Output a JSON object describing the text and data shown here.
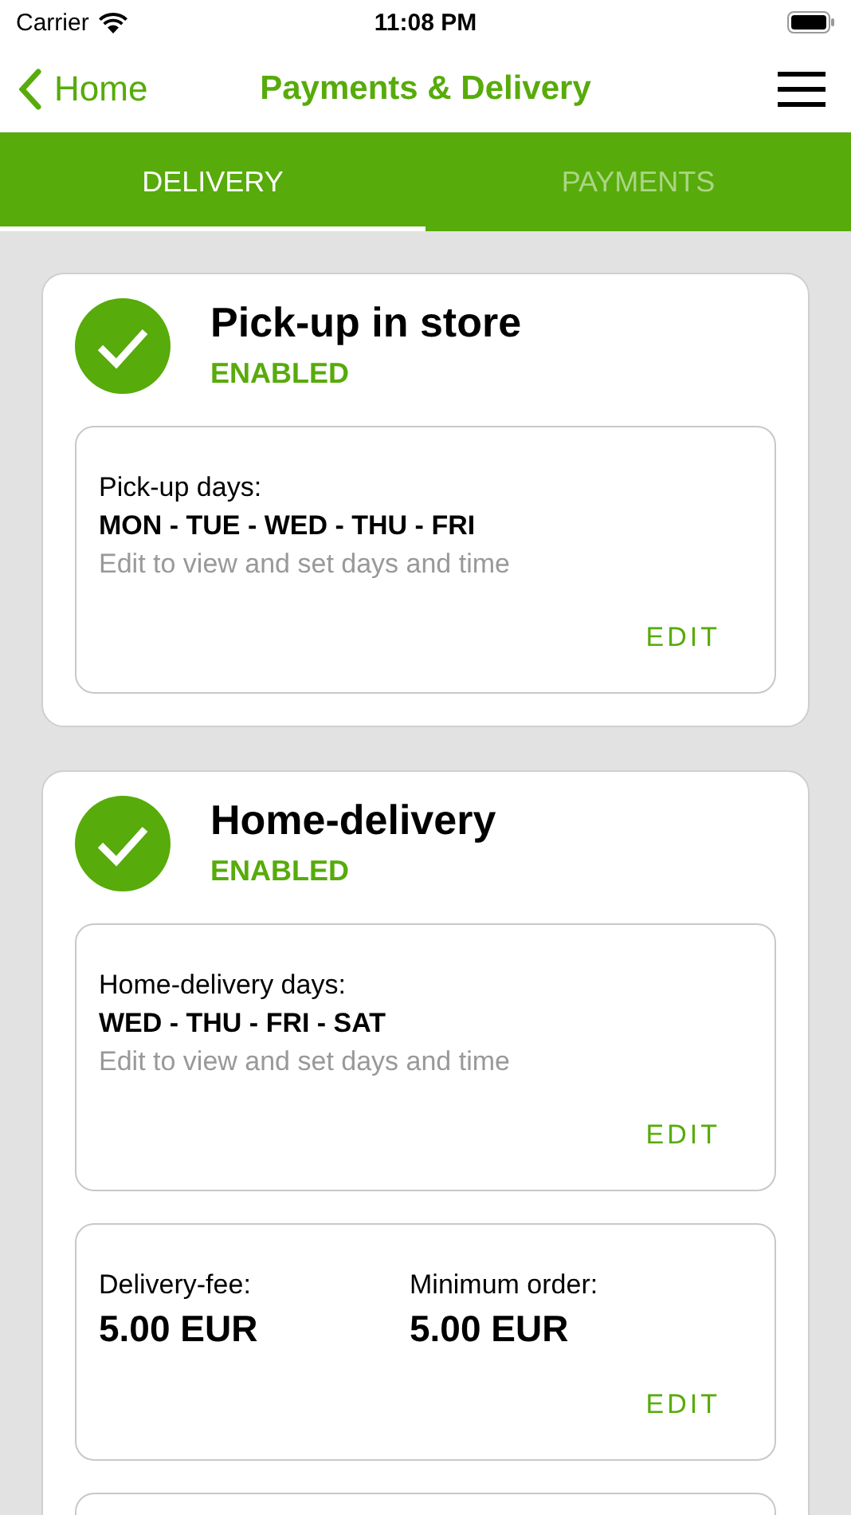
{
  "status_bar": {
    "carrier": "Carrier",
    "time": "11:08 PM"
  },
  "nav": {
    "back": "Home",
    "title": "Payments & Delivery"
  },
  "tabs": [
    {
      "label": "DELIVERY",
      "selected": true
    },
    {
      "label": "PAYMENTS",
      "selected": false
    }
  ],
  "cards": [
    {
      "title": "Pick-up in store",
      "status": "ENABLED",
      "enabled": true,
      "panels": [
        {
          "kind": "days",
          "label": "Pick-up days:",
          "days": "MON - TUE - WED - THU - FRI",
          "hint": "Edit to view and set days and time",
          "action": "EDIT"
        }
      ]
    },
    {
      "title": "Home-delivery",
      "status": "ENABLED",
      "enabled": true,
      "panels": [
        {
          "kind": "days",
          "label": "Home-delivery days:",
          "days": "WED - THU - FRI - SAT",
          "hint": "Edit to view and set days and time",
          "action": "EDIT"
        },
        {
          "kind": "fees",
          "fields": [
            {
              "label": "Delivery-fee:",
              "value": "5.00 EUR"
            },
            {
              "label": "Minimum order:",
              "value": "5.00 EUR"
            }
          ],
          "action": "EDIT"
        }
      ]
    }
  ]
}
